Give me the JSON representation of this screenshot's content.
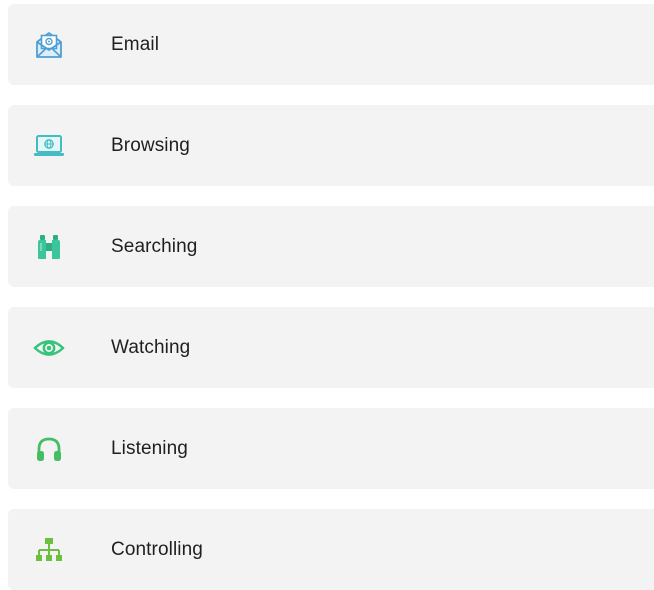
{
  "list": {
    "items": [
      {
        "label": "Email",
        "icon": "email-envelope-icon",
        "color": "#5aa6d6"
      },
      {
        "label": "Browsing",
        "icon": "laptop-globe-icon",
        "color": "#4cc1c6"
      },
      {
        "label": "Searching",
        "icon": "binoculars-icon",
        "color": "#3cc49a"
      },
      {
        "label": "Watching",
        "icon": "eye-icon",
        "color": "#39c27a"
      },
      {
        "label": "Listening",
        "icon": "headphones-icon",
        "color": "#45be63"
      },
      {
        "label": "Controlling",
        "icon": "network-hierarchy-icon",
        "color": "#6cbf3f"
      }
    ]
  }
}
